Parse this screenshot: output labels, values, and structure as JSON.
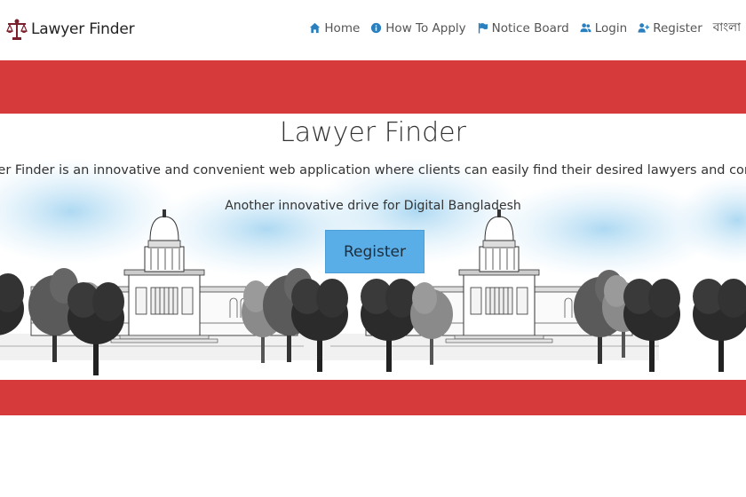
{
  "brand": {
    "name": "Lawyer Finder"
  },
  "nav": {
    "home": "Home",
    "how_to_apply": "How To Apply",
    "notice_board": "Notice Board",
    "login": "Login",
    "register": "Register",
    "language": "বাংলা"
  },
  "hero": {
    "title": "Lawyer Finder",
    "description": "Lawyer Finder is an innovative and convenient web application where clients can easily find their desired lawyers and communicate with them easily.",
    "subtitle": "Another innovative drive for Digital Bangladesh",
    "register_button": "Register"
  },
  "colors": {
    "band_red": "#d63a3a",
    "button_blue": "#5aaee8",
    "nav_icon_blue": "#2a7fbf",
    "logo_maroon": "#7a1f2b"
  },
  "icons": {
    "home": "home-icon",
    "how_to_apply": "info-circle-icon",
    "notice_board": "flag-icon",
    "login": "users-icon",
    "register": "user-plus-icon"
  }
}
